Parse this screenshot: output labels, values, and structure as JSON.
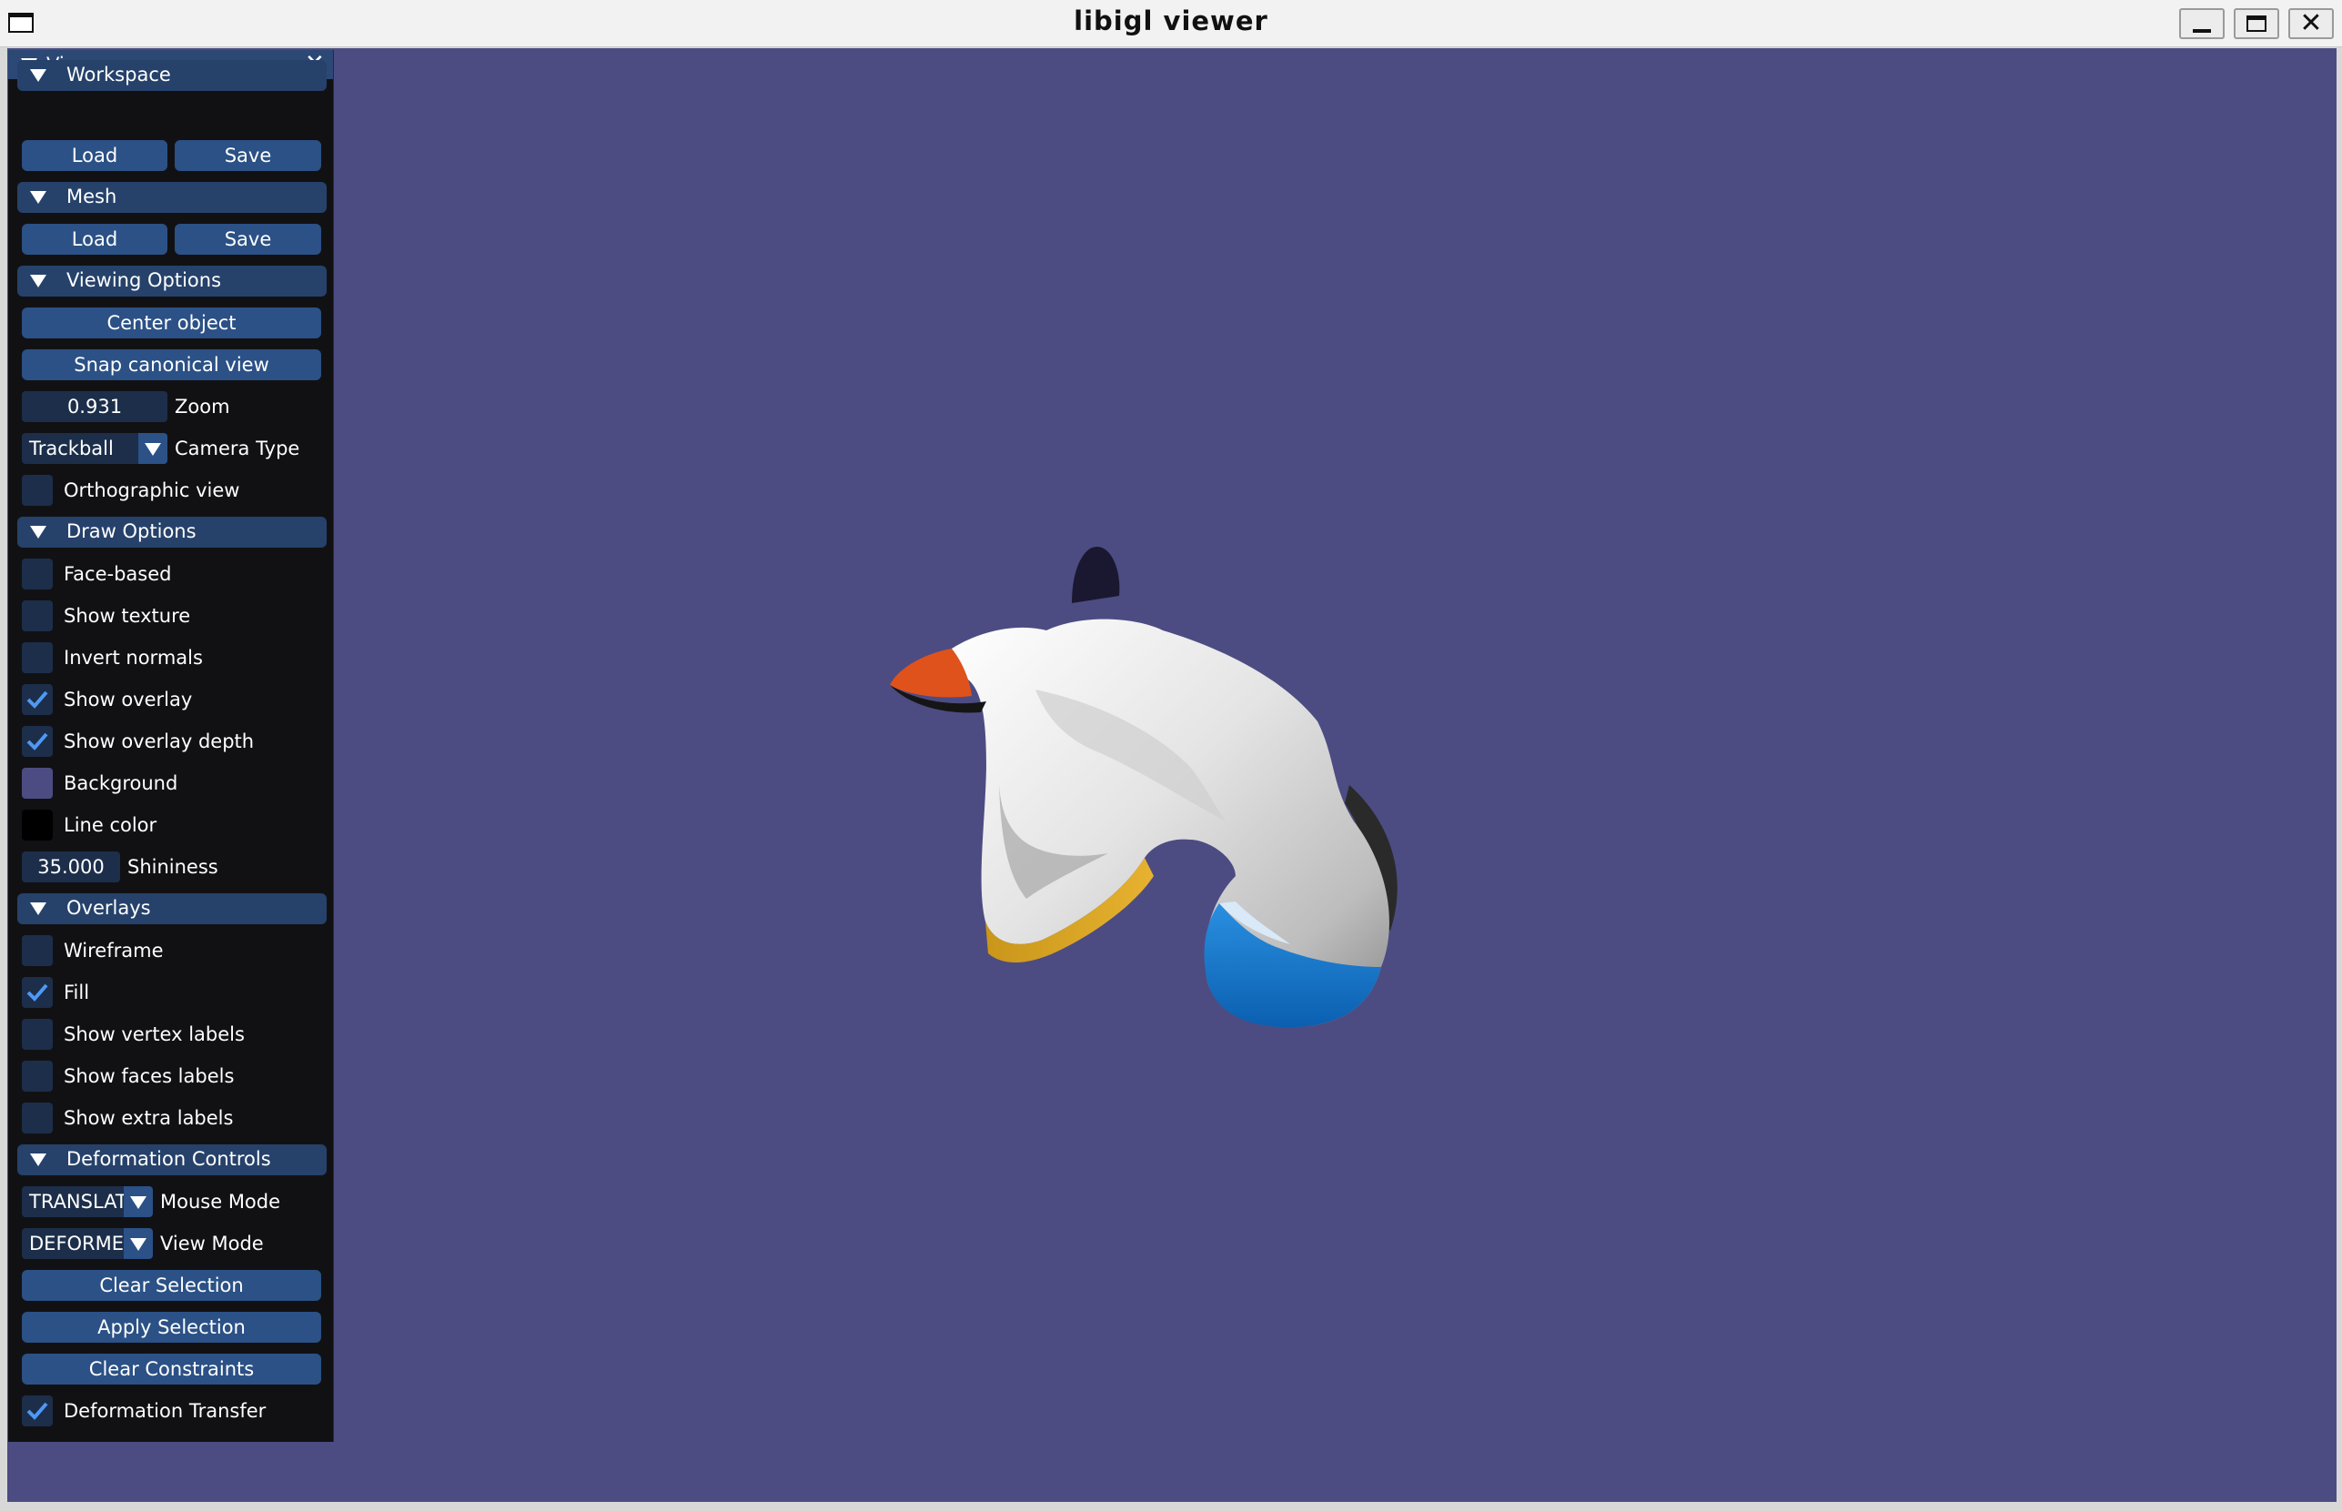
{
  "window": {
    "title": "libigl viewer",
    "minimize_glyph": "minimize-icon",
    "maximize_glyph": "maximize-icon",
    "close_glyph": "✕"
  },
  "colors": {
    "viewport_bg": "#4c4c83",
    "panel_bg": "#111114",
    "header_bg": "#26426b",
    "button_bg": "#2b5186",
    "field_bg": "#1c2e4a",
    "check_color": "#4f98f5",
    "line_color": "#000000"
  },
  "panel": {
    "title": "Viewer",
    "close_label": "✕",
    "workspace": {
      "header": "Workspace",
      "load": "Load",
      "save": "Save"
    },
    "mesh": {
      "header": "Mesh",
      "load": "Load",
      "save": "Save"
    },
    "viewing": {
      "header": "Viewing Options",
      "center_object": "Center object",
      "snap_view": "Snap canonical view",
      "zoom_value": "0.931",
      "zoom_label": "Zoom",
      "camera_value": "Trackball",
      "camera_label": "Camera Type",
      "ortho_label": "Orthographic view",
      "ortho_checked": false
    },
    "draw": {
      "header": "Draw Options",
      "items": [
        {
          "label": "Face-based",
          "checked": false
        },
        {
          "label": "Show texture",
          "checked": false
        },
        {
          "label": "Invert normals",
          "checked": false
        },
        {
          "label": "Show overlay",
          "checked": true
        },
        {
          "label": "Show overlay depth",
          "checked": true
        }
      ],
      "background_label": "Background",
      "line_color_label": "Line color",
      "shininess_value": "35.000",
      "shininess_label": "Shininess"
    },
    "overlays": {
      "header": "Overlays",
      "items": [
        {
          "label": "Wireframe",
          "checked": false
        },
        {
          "label": "Fill",
          "checked": true
        },
        {
          "label": "Show vertex labels",
          "checked": false
        },
        {
          "label": "Show faces labels",
          "checked": false
        },
        {
          "label": "Show extra labels",
          "checked": false
        }
      ]
    },
    "deformation": {
      "header": "Deformation Controls",
      "mouse_mode_value": "TRANSLAT",
      "mouse_mode_label": "Mouse Mode",
      "view_mode_value": "DEFORME",
      "view_mode_label": "View Mode",
      "clear_selection": "Clear Selection",
      "apply_selection": "Apply Selection",
      "clear_constraints": "Clear Constraints",
      "transfer_label": "Deformation Transfer",
      "transfer_checked": true
    }
  }
}
